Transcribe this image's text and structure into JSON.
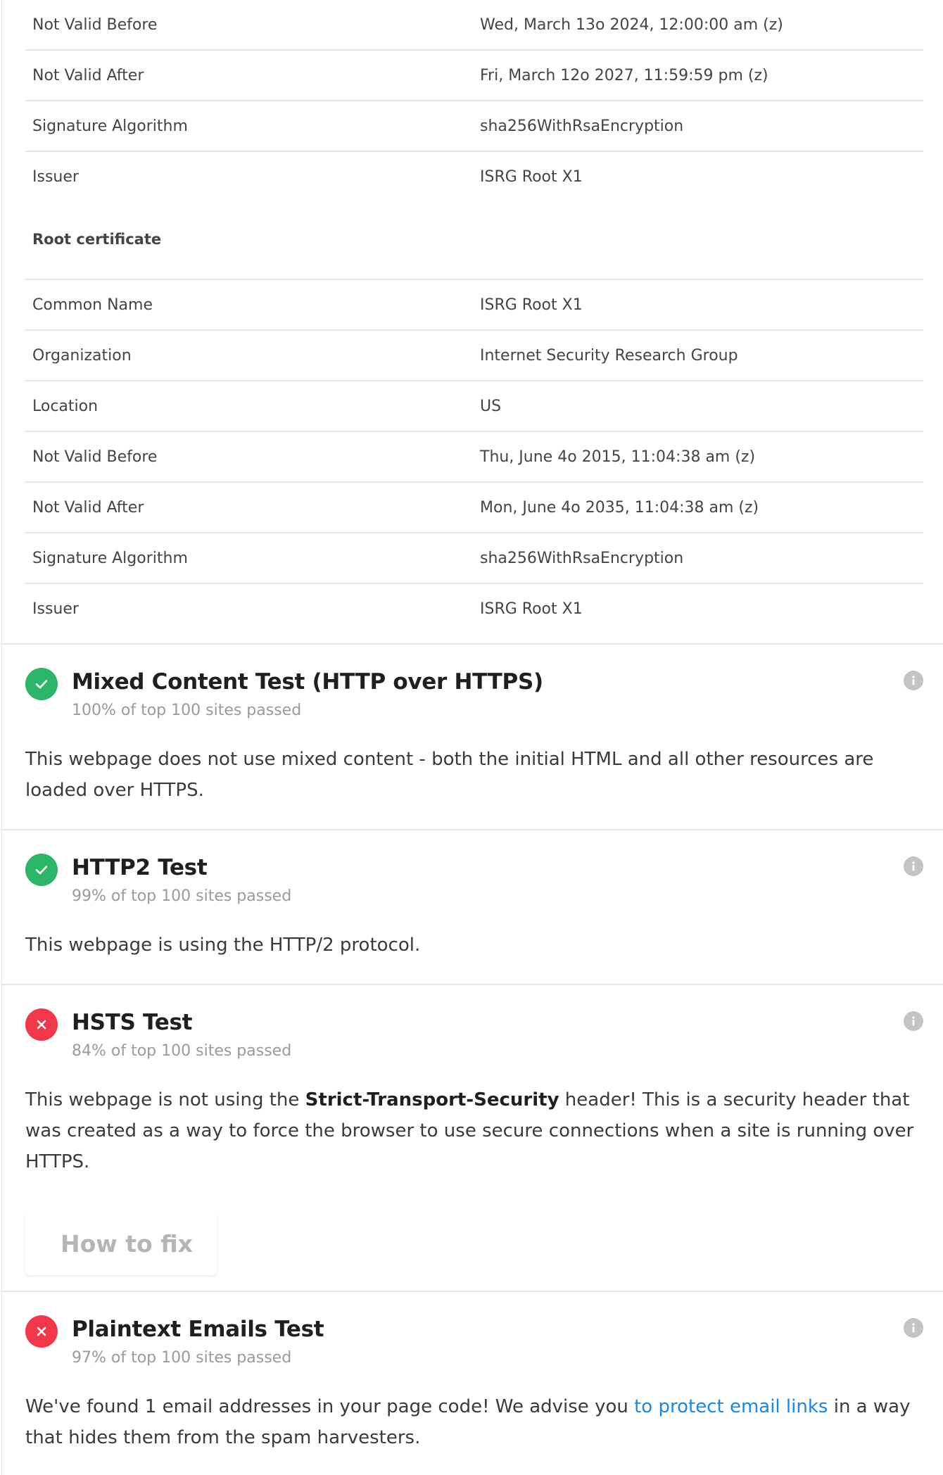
{
  "certificate": {
    "top_rows": [
      {
        "key": "Not Valid Before",
        "value": "Wed, March 13o 2024, 12:00:00 am (z)"
      },
      {
        "key": "Not Valid After",
        "value": "Fri, March 12o 2027, 11:59:59 pm (z)"
      },
      {
        "key": "Signature Algorithm",
        "value": "sha256WithRsaEncryption"
      },
      {
        "key": "Issuer",
        "value": "ISRG Root X1"
      }
    ],
    "root_heading": "Root certificate",
    "root_rows": [
      {
        "key": "Common Name",
        "value": "ISRG Root X1"
      },
      {
        "key": "Organization",
        "value": "Internet Security Research Group"
      },
      {
        "key": "Location",
        "value": "US"
      },
      {
        "key": "Not Valid Before",
        "value": "Thu, June 4o 2015, 11:04:38 am (z)"
      },
      {
        "key": "Not Valid After",
        "value": "Mon, June 4o 2035, 11:04:38 am (z)"
      },
      {
        "key": "Signature Algorithm",
        "value": "sha256WithRsaEncryption"
      },
      {
        "key": "Issuer",
        "value": "ISRG Root X1"
      }
    ]
  },
  "tests": {
    "mixed": {
      "title": "Mixed Content Test (HTTP over HTTPS)",
      "subtitle": "100% of top 100 sites passed",
      "status": "pass",
      "description": "This webpage does not use mixed content - both the initial HTML and all other resources are loaded over HTTPS."
    },
    "http2": {
      "title": "HTTP2 Test",
      "subtitle": "99% of top 100 sites passed",
      "status": "pass",
      "description": "This webpage is using the HTTP/2 protocol."
    },
    "hsts": {
      "title": "HSTS Test",
      "subtitle": "84% of top 100 sites passed",
      "status": "fail",
      "desc_before": "This webpage is not using the ",
      "desc_bold": "Strict-Transport-Security",
      "desc_after": " header! This is a security header that was created as a way to force the browser to use secure connections when a site is running over HTTPS.",
      "fix_label": "How to fix"
    },
    "emails": {
      "title": "Plaintext Emails Test",
      "subtitle": "97% of top 100 sites passed",
      "status": "fail",
      "desc_before": "We've found 1 email addresses in your page code! We advise you ",
      "desc_link": "to protect email links",
      "desc_after": " in a way that hides them from the spam harvesters."
    }
  },
  "colors": {
    "pass": "#2db56a",
    "fail": "#f0384a",
    "link": "#1a86e0",
    "info": "#c4c4c4"
  },
  "icons": {
    "pass": "check-icon",
    "fail": "cross-icon",
    "info": "info-icon"
  }
}
